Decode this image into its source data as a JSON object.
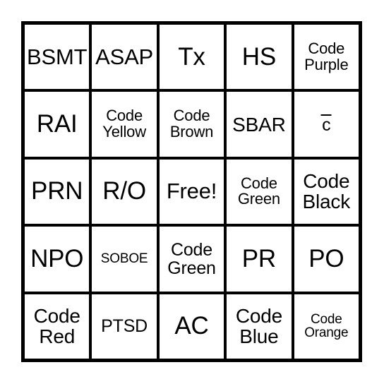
{
  "card": {
    "type": "bingo-card",
    "grid_rows": 5,
    "grid_columns": 5,
    "border_color": "#000000",
    "cell_background": "#ffffff",
    "page_background": "#ffffff",
    "free_space": "Free!",
    "free_space_position": "row 3, column 3",
    "cells": [
      {
        "text": "BSMT",
        "size": "lg",
        "lines": 1
      },
      {
        "text": "ASAP",
        "size": "lg",
        "lines": 1
      },
      {
        "text": "Tx",
        "size": "xl",
        "lines": 1
      },
      {
        "text": "HS",
        "size": "xl",
        "lines": 1
      },
      {
        "text": "Code\nPurple",
        "size": "sm",
        "lines": 2
      },
      {
        "text": "RAI",
        "size": "xl",
        "lines": 1
      },
      {
        "text": "Code\nYellow",
        "size": "sm",
        "lines": 2
      },
      {
        "text": "Code\nBrown",
        "size": "sm",
        "lines": 2
      },
      {
        "text": "SBAR",
        "size": "ml",
        "lines": 1
      },
      {
        "text": "c",
        "size": "md",
        "lines": 1,
        "overline": true
      },
      {
        "text": "PRN",
        "size": "xl",
        "lines": 1
      },
      {
        "text": "R/O",
        "size": "xl",
        "lines": 1
      },
      {
        "text": "Free!",
        "size": "lg",
        "lines": 1
      },
      {
        "text": "Code\nGreen",
        "size": "sm",
        "lines": 2
      },
      {
        "text": "Code\nBlack",
        "size": "ml",
        "lines": 2
      },
      {
        "text": "NPO",
        "size": "xl",
        "lines": 1
      },
      {
        "text": "SOBOE",
        "size": "xs",
        "lines": 1
      },
      {
        "text": "Code\nGreen",
        "size": "md",
        "lines": 2
      },
      {
        "text": "PR",
        "size": "xl",
        "lines": 1
      },
      {
        "text": "PO",
        "size": "xl",
        "lines": 1
      },
      {
        "text": "Code\nRed",
        "size": "ml",
        "lines": 2
      },
      {
        "text": "PTSD",
        "size": "md",
        "lines": 1
      },
      {
        "text": "AC",
        "size": "xl",
        "lines": 1
      },
      {
        "text": "Code\nBlue",
        "size": "ml",
        "lines": 2
      },
      {
        "text": "Code\nOrange",
        "size": "xs",
        "lines": 2
      }
    ]
  }
}
